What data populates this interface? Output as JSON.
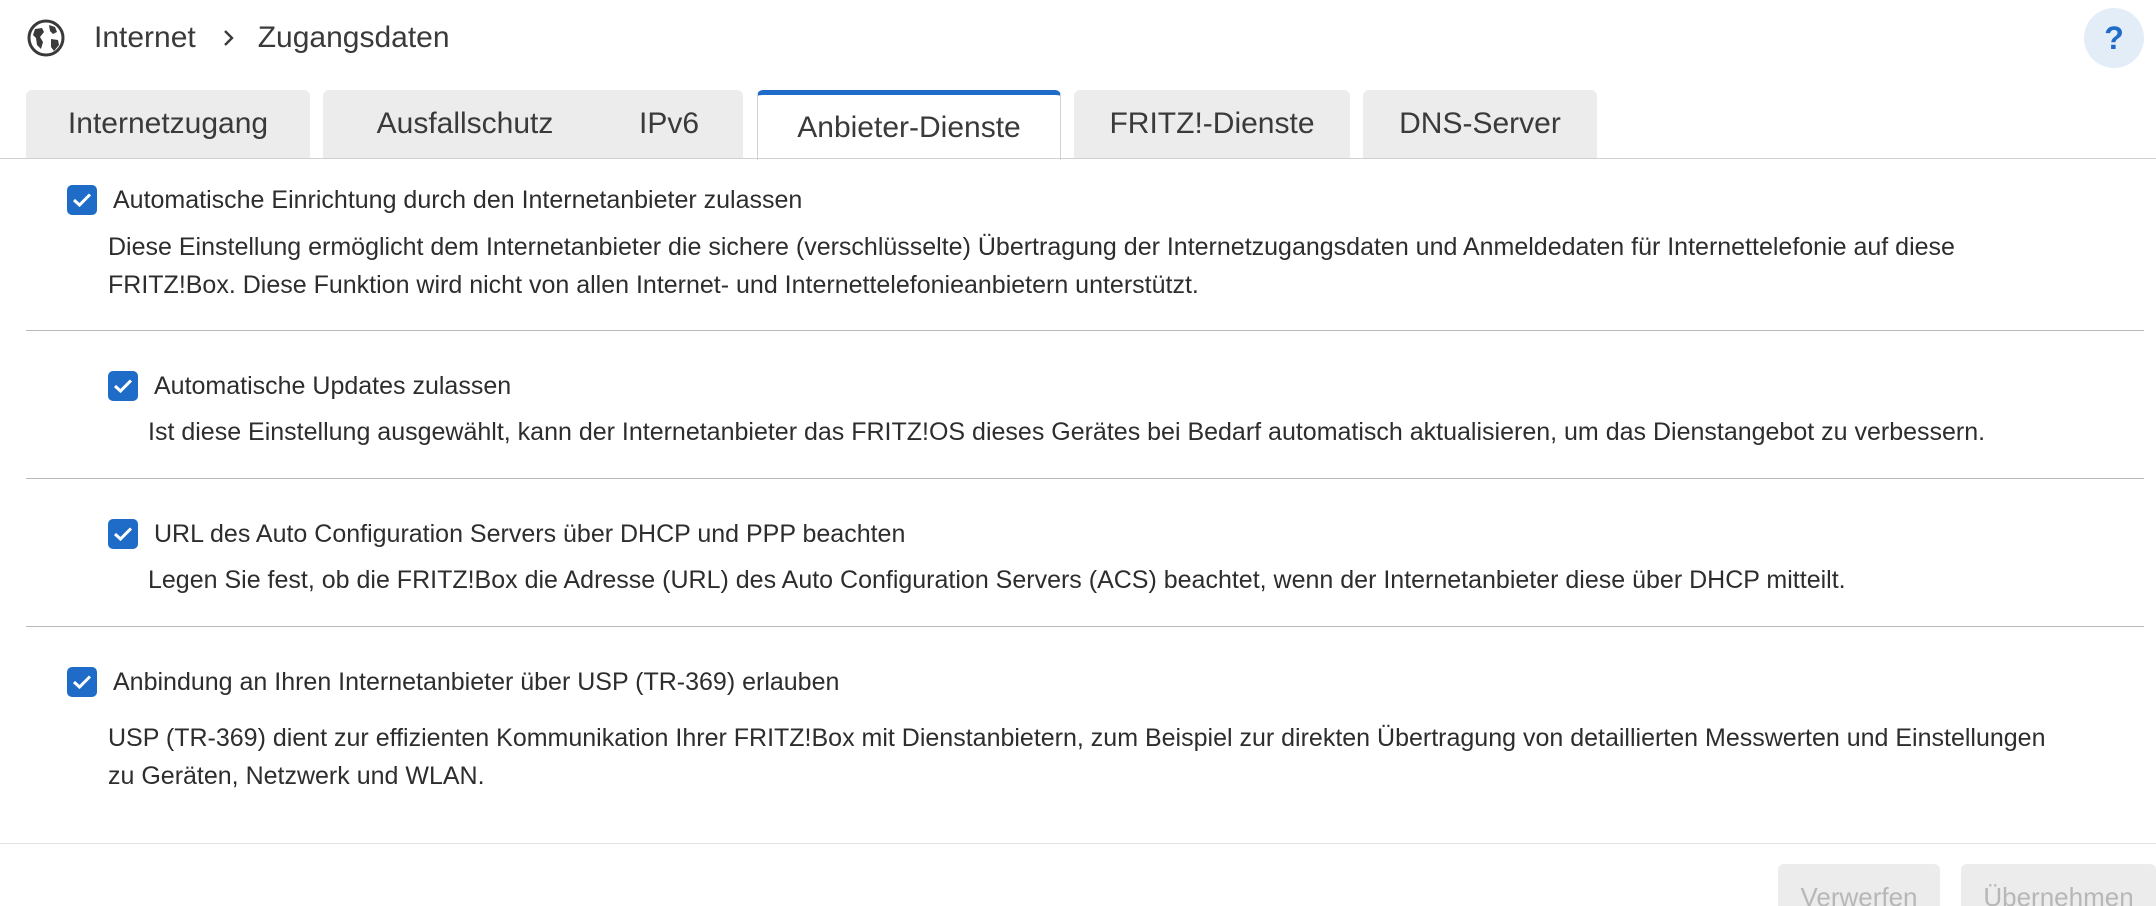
{
  "header": {
    "icon": "globe-icon",
    "breadcrumb": [
      "Internet",
      "Zugangsdaten"
    ],
    "help_label": "?"
  },
  "tabs": [
    {
      "label": "Internetzugang",
      "active": false
    },
    {
      "label": "Ausfallschutz",
      "active": false
    },
    {
      "label": "IPv6",
      "active": false
    },
    {
      "label": "Anbieter-Dienste",
      "active": true
    },
    {
      "label": "FRITZ!-Dienste",
      "active": false
    },
    {
      "label": "DNS-Server",
      "active": false
    }
  ],
  "sections": [
    {
      "checked": true,
      "title": "Automatische Einrichtung durch den Internetanbieter zulassen",
      "description_lines": [
        "Diese Einstellung ermöglicht dem Internetanbieter die sichere (verschlüsselte) Übertragung der Internetzugangsdaten und Anmeldedaten für Internettelefonie auf diese",
        "FRITZ!Box. Diese Funktion wird nicht von allen Internet- und Internettelefonieanbietern unterstützt."
      ]
    },
    {
      "checked": true,
      "title": "Automatische Updates zulassen",
      "description_lines": [
        "Ist diese Einstellung ausgewählt, kann der Internetanbieter das FRITZ!OS dieses Gerätes bei Bedarf automatisch aktualisieren, um das Dienstangebot zu verbessern."
      ]
    },
    {
      "checked": true,
      "title": "URL des Auto Configuration Servers über DHCP und PPP beachten",
      "description_lines": [
        "Legen Sie fest, ob die FRITZ!Box die Adresse (URL) des Auto Configuration Servers (ACS) beachtet, wenn der Internetanbieter diese über DHCP mitteilt."
      ]
    },
    {
      "checked": true,
      "title": "Anbindung an Ihren Internetanbieter über USP (TR-369) erlauben",
      "description_lines": [
        "USP (TR-369) dient zur effizienten Kommunikation Ihrer FRITZ!Box mit Dienstanbietern, zum Beispiel zur direkten Übertragung von detaillierten Messwerten und Einstellungen",
        "zu Geräten, Netzwerk und WLAN."
      ]
    }
  ],
  "footer": {
    "discard_label": "Verwerfen",
    "apply_label": "Übernehmen"
  },
  "colors": {
    "accent": "#1e6bc8",
    "tab_inactive": "#ececec",
    "button_disabled_text": "#b7b7b7"
  }
}
